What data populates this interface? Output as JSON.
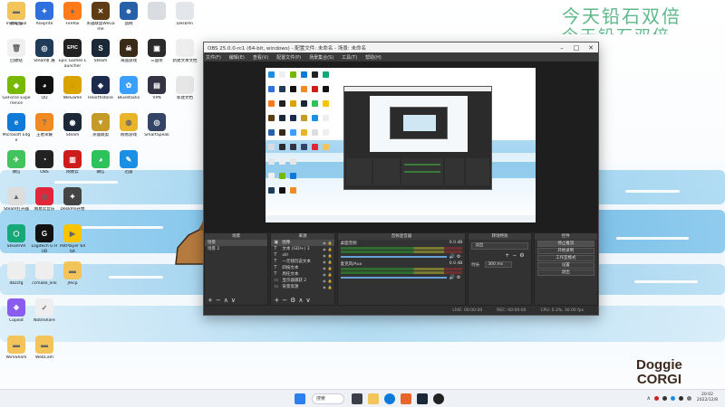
{
  "wallpaper": {
    "title_line1": "今天铅石双倍",
    "title_line2": "今天铅石双倍",
    "brand_line1": "Doggie",
    "brand_line2": "CORGI"
  },
  "desktop_icons": [
    {
      "label": "此电脑",
      "color": "#1a8fe3",
      "glyph": "▭"
    },
    {
      "label": "Aseprite",
      "color": "#2f6fde",
      "glyph": "✦"
    },
    {
      "label": "Firefox",
      "color": "#ff7b1a",
      "glyph": "●"
    },
    {
      "label": "英雄联盟WeGame",
      "color": "#5e3c14",
      "glyph": "✕"
    },
    {
      "label": "战网",
      "color": "#2560a8",
      "glyph": "☻"
    },
    {
      "label": "",
      "color": "#d9dde2",
      "glyph": ""
    },
    {
      "label": "DeskPin",
      "color": "#e3e6ea",
      "glyph": ""
    },
    {
      "label": "回收站",
      "color": "#f0f0f0",
      "glyph": "🗑"
    },
    {
      "label": "Steam扩展",
      "color": "#1e3b57",
      "glyph": "◎"
    },
    {
      "label": "Epic Games Launcher",
      "color": "#222222",
      "glyph": "EPIC"
    },
    {
      "label": "Steam",
      "color": "#1b2838",
      "glyph": "S"
    },
    {
      "label": "海盗游戏",
      "color": "#3a2a18",
      "glyph": "☠"
    },
    {
      "label": "三国杀",
      "color": "#2b2b2b",
      "glyph": "▣"
    },
    {
      "label": "新建文本文档",
      "color": "#eeeeee",
      "glyph": ""
    },
    {
      "label": "GeForce Experience",
      "color": "#76b900",
      "glyph": "◆"
    },
    {
      "label": "QQ",
      "color": "#111111",
      "glyph": "◕"
    },
    {
      "label": "WeGame",
      "color": "#d9a400",
      "glyph": "◌"
    },
    {
      "label": "Hearthstone",
      "color": "#1c2b4d",
      "glyph": "◈"
    },
    {
      "label": "Bluestacks",
      "color": "#3aa0ff",
      "glyph": "✿"
    },
    {
      "label": "VPN",
      "color": "#333344",
      "glyph": "▤"
    },
    {
      "label": "新建文档",
      "color": "#e6e6e6",
      "glyph": ""
    },
    {
      "label": "Microsoft Edge",
      "color": "#0f7ad8",
      "glyph": "e"
    },
    {
      "label": "王者荣耀",
      "color": "#f08a24",
      "glyph": "?"
    },
    {
      "label": "Steam",
      "color": "#1b2838",
      "glyph": "◉"
    },
    {
      "label": "英雄联盟",
      "color": "#c49a28",
      "glyph": "▼"
    },
    {
      "label": "网易游戏",
      "color": "#e8b42a",
      "glyph": "◍"
    },
    {
      "label": "SmartSpeak",
      "color": "#334466",
      "glyph": "◎"
    },
    {
      "label": "微信",
      "color": "#43c35e",
      "glyph": "✈"
    },
    {
      "label": "OBS",
      "color": "#222222",
      "glyph": "◔"
    },
    {
      "label": "网易云",
      "color": "#cc1c1c",
      "glyph": "▥"
    },
    {
      "label": "微信",
      "color": "#2ec25c",
      "glyph": "◕"
    },
    {
      "label": "迅雷",
      "color": "#1a8fe3",
      "glyph": "✎"
    },
    {
      "label": "Steam打开器",
      "color": "#dddddd",
      "glyph": "▲"
    },
    {
      "label": "网易云音乐",
      "color": "#e0263b",
      "glyph": "◎"
    },
    {
      "label": "DeskPin开始",
      "color": "#444444",
      "glyph": "✦"
    },
    {
      "label": "SteamVR",
      "color": "#17a878",
      "glyph": "⬡"
    },
    {
      "label": "Logitech G HUB",
      "color": "#111111",
      "glyph": "G"
    },
    {
      "label": "PotPlayer 64 bit",
      "color": "#f6c400",
      "glyph": "▶"
    },
    {
      "label": "dbzcfg",
      "color": "#eeeeee",
      "glyph": ""
    },
    {
      "label": "ccmake_link",
      "color": "#eeeeee",
      "glyph": ""
    },
    {
      "label": "jfecp",
      "color": "#f2c45a",
      "glyph": "▬"
    },
    {
      "label": "Copilot",
      "color": "#8a5cf0",
      "glyph": "❖"
    },
    {
      "label": "NoteShare",
      "color": "#eeeeee",
      "glyph": "✓"
    },
    {
      "label": "WireShark",
      "color": "#f2c45a",
      "glyph": "▬"
    },
    {
      "label": "WebCam",
      "color": "#f2c45a",
      "glyph": "▬"
    },
    {
      "label": "Video Tool",
      "color": "#f2c45a",
      "glyph": "▬"
    }
  ],
  "obs": {
    "title": "OBS 25.0.0-rc1 (64-bit, windows) - 配置文件: 未命名 - 场景: 未命名",
    "menu": [
      "文件(F)",
      "编辑(E)",
      "查看(V)",
      "配置文件(P)",
      "场景集合(S)",
      "工具(T)",
      "帮助(H)"
    ],
    "docks": {
      "scenes": {
        "header": "场景",
        "items": [
          "场景",
          "场景 2"
        ]
      },
      "sources": {
        "header": "来源",
        "items": [
          {
            "icon": "▣",
            "name": "图像"
          },
          {
            "icon": "T",
            "name": "文本 (GDI+) 3"
          },
          {
            "icon": "T",
            "name": "xlll"
          },
          {
            "icon": "T",
            "name": "一元钱玩说文本"
          },
          {
            "icon": "T",
            "name": "四按文本"
          },
          {
            "icon": "T",
            "name": "周任文本"
          },
          {
            "icon": "▭",
            "name": "显示器捕获 2"
          },
          {
            "icon": "▭",
            "name": "背景资源"
          }
        ]
      },
      "mixer": {
        "header": "音频混音器",
        "channels": [
          {
            "name": "桌面音频",
            "db": "0.0 dB"
          },
          {
            "name": "麦克风/Aux",
            "db": "0.0 dB"
          }
        ]
      },
      "transitions": {
        "header": "转场特效",
        "selected": "淡出",
        "duration_label": "时长",
        "duration_value": "300 ms"
      },
      "controls": {
        "header": "控件",
        "buttons": [
          "停止推流",
          "开始录制",
          "工作室模式",
          "设置",
          "退出"
        ]
      }
    },
    "status": {
      "live": "LIVE: 00:00:00",
      "rec": "REC: 00:00:00",
      "cpu": "CPU: 0.3%, 30.00 fps"
    }
  },
  "taskbar": {
    "search": "搜索",
    "time": "20:02",
    "date": "2022/12/8"
  }
}
